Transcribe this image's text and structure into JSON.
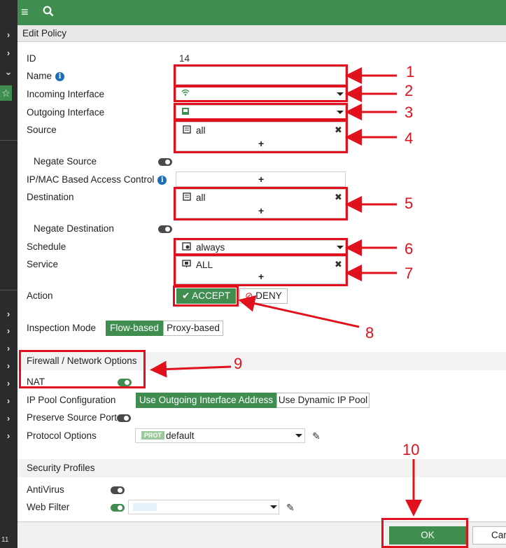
{
  "topbar": {
    "menu_icon": "hamburger-icon",
    "search_icon": "search-icon"
  },
  "header": {
    "title": "Edit Policy"
  },
  "form": {
    "id_label": "ID",
    "id_value": "14",
    "name_label": "Name",
    "name_value": "",
    "incoming_label": "Incoming Interface",
    "outgoing_label": "Outgoing Interface",
    "source_label": "Source",
    "source_value": "all",
    "negate_source_label": "Negate Source",
    "ipmac_label": "IP/MAC Based Access Control",
    "destination_label": "Destination",
    "destination_value": "all",
    "negate_destination_label": "Negate Destination",
    "schedule_label": "Schedule",
    "schedule_value": "always",
    "service_label": "Service",
    "service_value": "ALL",
    "action_label": "Action",
    "accept_label": "ACCEPT",
    "deny_label": "DENY",
    "inspection_label": "Inspection Mode",
    "flow_label": "Flow-based",
    "proxy_label": "Proxy-based",
    "plus": "+"
  },
  "firewall": {
    "section_title": "Firewall / Network Options",
    "nat_label": "NAT",
    "nat_enabled": true,
    "ippool_label": "IP Pool Configuration",
    "use_outgoing_label": "Use Outgoing Interface Address",
    "use_dynamic_label": "Use Dynamic IP Pool",
    "preserve_label": "Preserve Source Port",
    "protocol_label": "Protocol Options",
    "protocol_badge": "PROT",
    "protocol_value": "default"
  },
  "security": {
    "section_title": "Security Profiles",
    "antivirus_label": "AntiVirus",
    "webfilter_label": "Web Filter"
  },
  "footer": {
    "ok_label": "OK",
    "cancel_label": "Car"
  },
  "sidebar": {
    "bottom_number": "11"
  },
  "annotations": [
    "1",
    "2",
    "3",
    "4",
    "5",
    "6",
    "7",
    "8",
    "9",
    "10"
  ],
  "colors": {
    "accent": "#3f8d4f",
    "highlight": "#e0101c",
    "info": "#1a6eb5"
  }
}
